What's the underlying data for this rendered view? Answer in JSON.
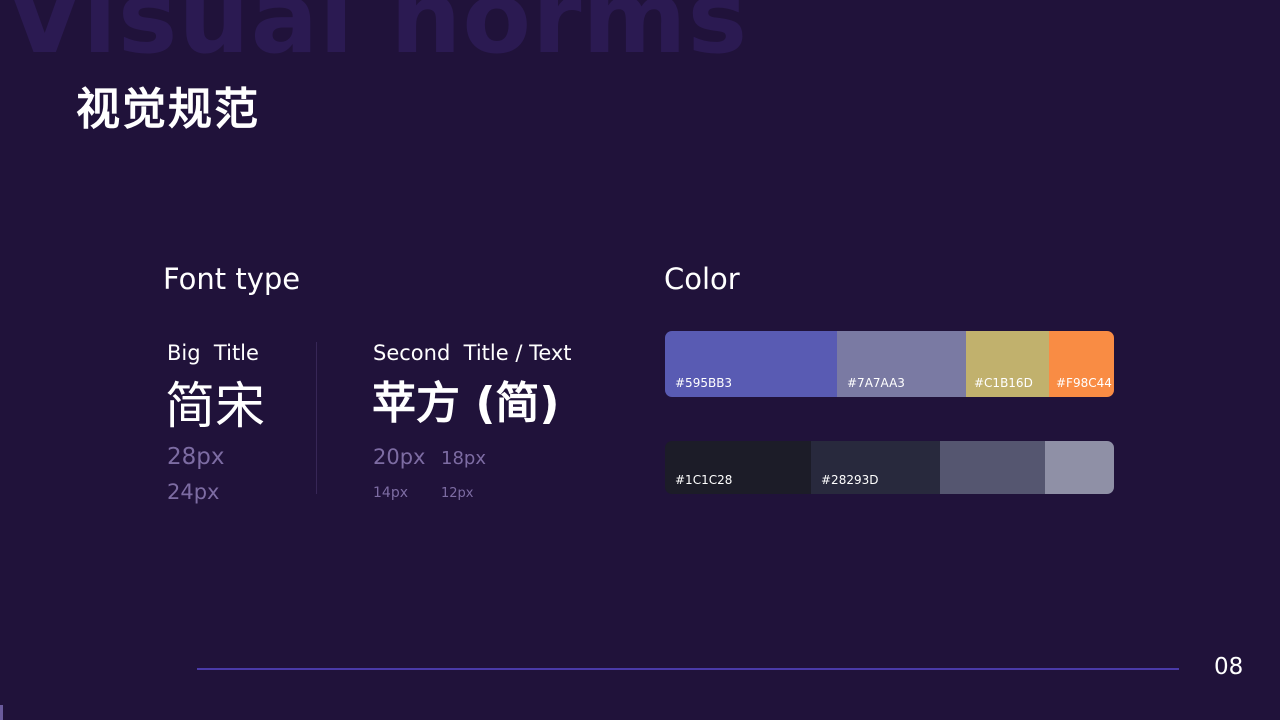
{
  "watermark": "Visual norms",
  "title": "视觉规范",
  "font_section": {
    "heading": "Font type",
    "big": {
      "label": "Big  Title",
      "sample": "简宋",
      "sizes": [
        "28px",
        "24px"
      ]
    },
    "second": {
      "label": "Second  Title / Text",
      "sample": "苹方 (简)",
      "sizes": [
        "20px",
        "18px",
        "14px",
        "12px"
      ]
    }
  },
  "color_section": {
    "heading": "Color",
    "palette_top": [
      {
        "hex": "#595BB3",
        "label": "#595BB3"
      },
      {
        "hex": "#7A7AA3",
        "label": "#7A7AA3"
      },
      {
        "hex": "#C1B16D",
        "label": "#C1B16D"
      },
      {
        "hex": "#F98C44",
        "label": "#F98C44"
      }
    ],
    "palette_bottom": [
      {
        "hex": "#1C1C28",
        "label": "#1C1C28"
      },
      {
        "hex": "#28293D",
        "label": "#28293D"
      },
      {
        "hex": "#555670",
        "label": ""
      },
      {
        "hex": "#8F90A6",
        "label": ""
      }
    ]
  },
  "page_number": "08",
  "colors": {
    "background": "#20123a",
    "accent_line": "#4a3aa8",
    "muted_text": "#7d6ca3"
  }
}
